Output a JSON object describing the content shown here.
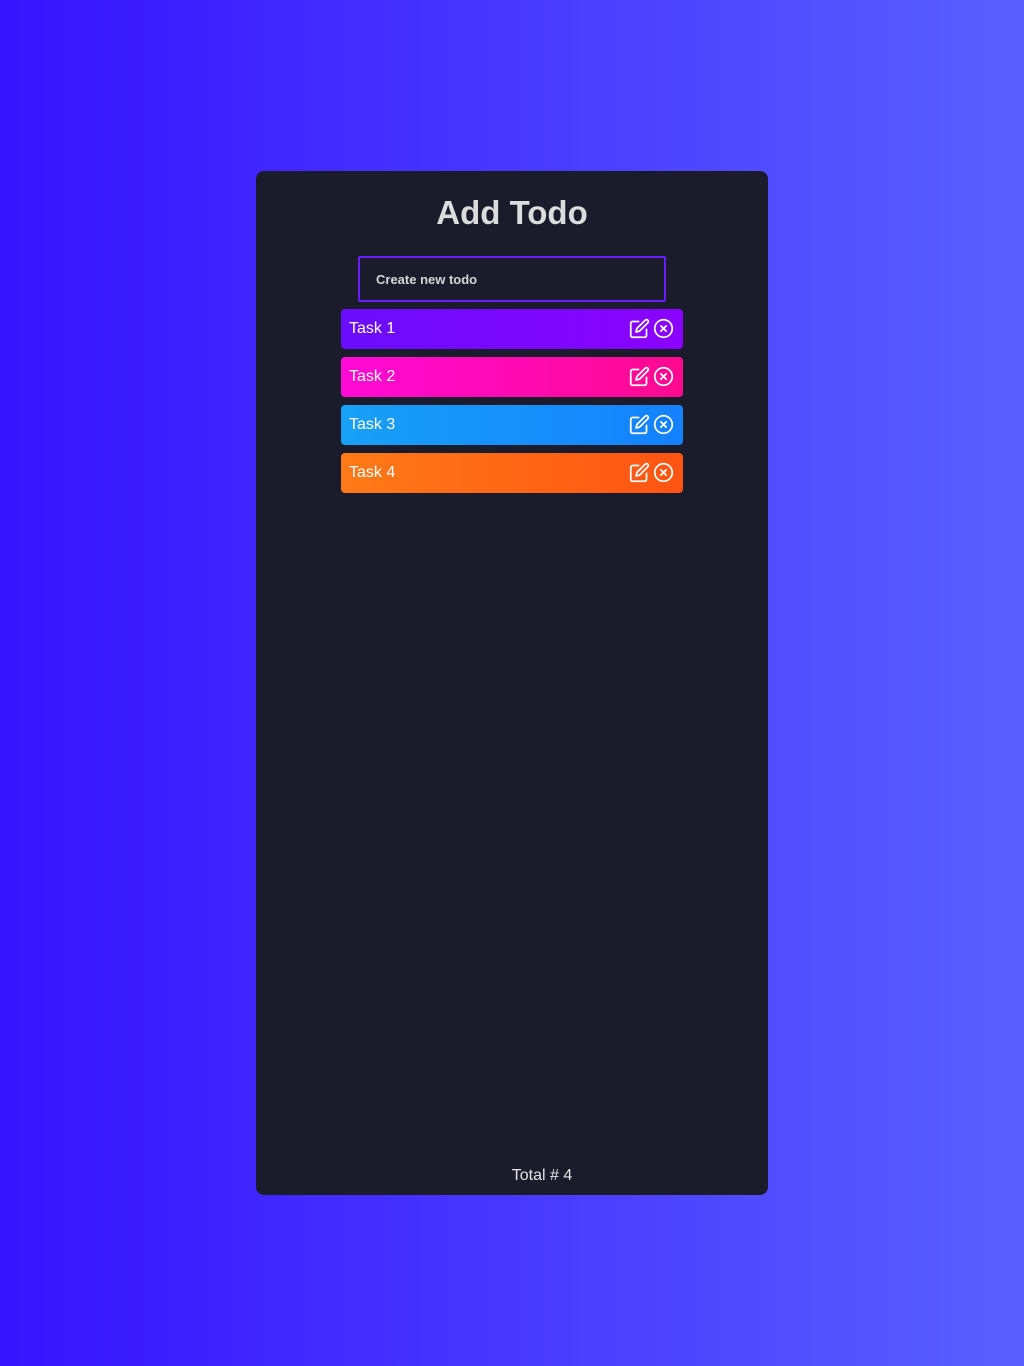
{
  "app": {
    "title": "Add Todo"
  },
  "new_todo": {
    "placeholder": "Create new todo",
    "value": ""
  },
  "todos": [
    {
      "label": "Task 1",
      "color_from": "#6a0dfc",
      "color_to": "#8b02ff"
    },
    {
      "label": "Task 2",
      "color_from": "#ff0ad6",
      "color_to": "#ff0a8e"
    },
    {
      "label": "Task 3",
      "color_from": "#18a0f6",
      "color_to": "#1481ff"
    },
    {
      "label": "Task 4",
      "color_from": "#ff7a18",
      "color_to": "#ff5412"
    }
  ],
  "item_icons": {
    "edit": "edit-icon",
    "delete": "close-circle-icon"
  },
  "footer": {
    "total_label": "Total # 4"
  },
  "colors": {
    "background_from": "#3712ff",
    "background_to": "#5a60ff",
    "card": "#1a1c2b",
    "input_border": "#6a1bff"
  }
}
